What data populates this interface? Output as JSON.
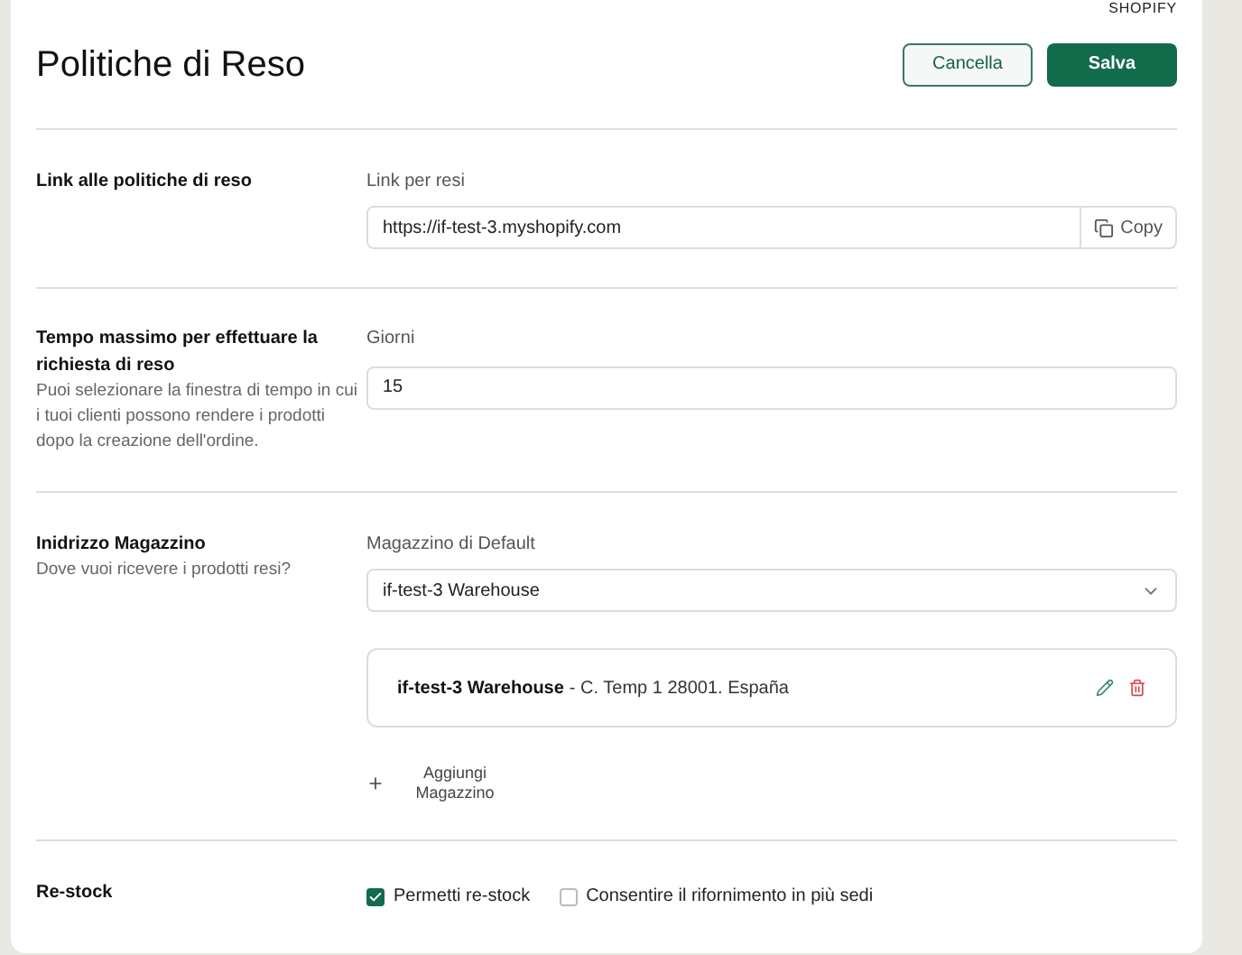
{
  "brand": "SHOPIFY",
  "title": "Politiche di Reso",
  "buttons": {
    "cancel": "Cancella",
    "save": "Salva"
  },
  "link_section": {
    "title": "Link alle politiche di reso",
    "field_label": "Link per resi",
    "value": "https://if-test-3.myshopify.com",
    "copy_label": "Copy"
  },
  "time_section": {
    "title": "Tempo massimo per effettuare la richiesta di reso",
    "description": "Puoi selezionare la finestra di tempo in cui i tuoi clienti possono rendere i prodotti dopo la creazione dell'ordine.",
    "field_label": "Giorni",
    "value": "15"
  },
  "warehouse_section": {
    "title": "Inidrizzo Magazzino",
    "description": "Dove vuoi ricevere i prodotti resi?",
    "field_label": "Magazzino di Default",
    "selected_value": "if-test-3 Warehouse",
    "warehouses": [
      {
        "name": "if-test-3 Warehouse",
        "address": "- C. Temp 1 28001. España"
      }
    ],
    "add_label": "Aggiungi Magazzino"
  },
  "restock_section": {
    "title": "Re-stock",
    "options": [
      {
        "label": "Permetti re-stock",
        "checked": true
      },
      {
        "label": "Consentire il rifornimento in più sedi",
        "checked": false
      }
    ]
  }
}
